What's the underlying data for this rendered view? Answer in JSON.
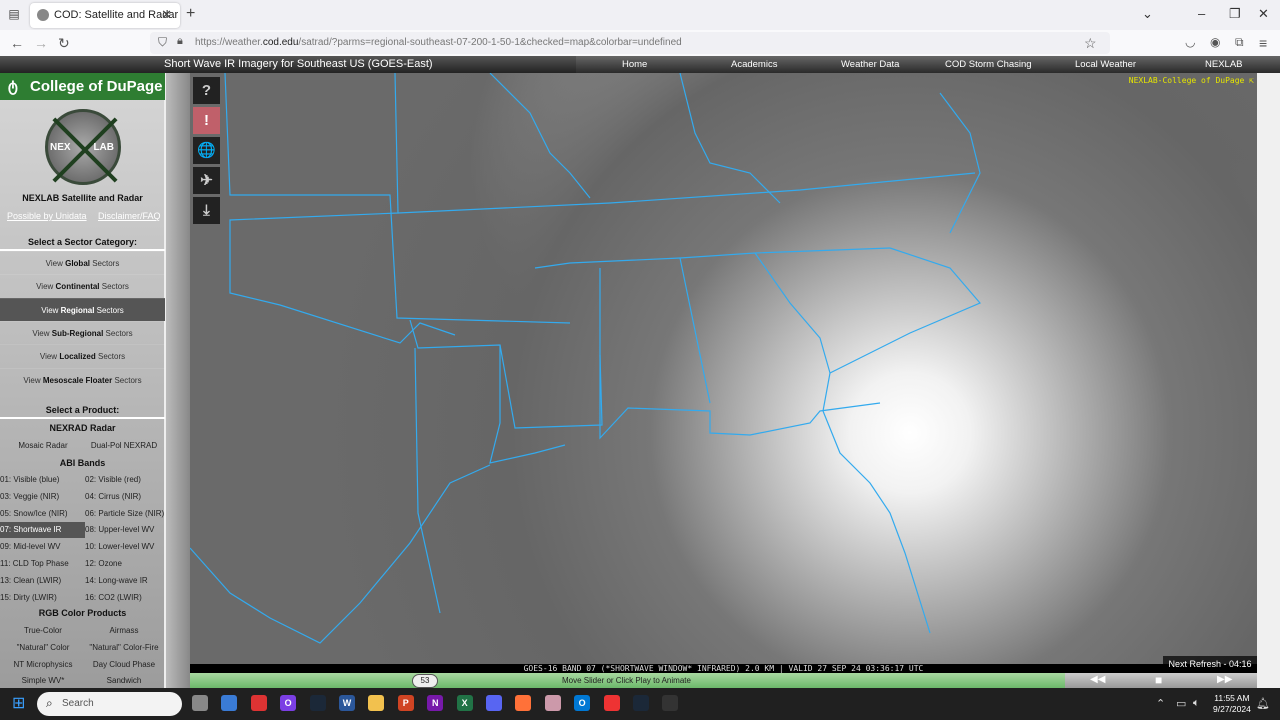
{
  "browser": {
    "tab_title": "COD: Satellite and Radar",
    "url_prefix": "https://weather.",
    "url_domain": "cod.edu",
    "url_path": "/satrad/?parms=regional-southeast-07-200-1-50-1&checked=map&colorbar=undefined",
    "icons": {
      "back": "←",
      "forward": "→",
      "reload": "↻",
      "star": "☆",
      "menu": "≡",
      "close": "✕",
      "new_tab": "+",
      "minimize": "–",
      "restore": "❐",
      "tab_list": "⌄"
    }
  },
  "site": {
    "page_title": "Short Wave IR Imagery for Southeast US (GOES-East)",
    "menu": [
      "Home",
      "Academics",
      "Weather Data",
      "COD Storm Chasing",
      "Local Weather",
      "NEXLAB"
    ],
    "logo_text": "College of DuPage",
    "nexlab_left": "NEX",
    "nexlab_right": "LAB",
    "watermark": "NEXLAB-College of DuPage ⇱"
  },
  "sidebar": {
    "heading": "NEXLAB Satellite and Radar",
    "link_unidata": "Possible by Unidata",
    "link_disclaimer": "Disclaimer/FAQ",
    "sector_heading": "Select a Sector Category:",
    "sectors": [
      {
        "pre": "View ",
        "bold": "Global",
        "post": " Sectors",
        "active": false
      },
      {
        "pre": "View ",
        "bold": "Continental",
        "post": " Sectors",
        "active": false
      },
      {
        "pre": "View ",
        "bold": "Regional",
        "post": " Sectors",
        "active": true
      },
      {
        "pre": "View ",
        "bold": "Sub-Regional",
        "post": " Sectors",
        "active": false
      },
      {
        "pre": "View ",
        "bold": "Localized",
        "post": " Sectors",
        "active": false
      },
      {
        "pre": "View ",
        "bold": "Mesoscale Floater",
        "post": " Sectors",
        "active": false
      }
    ],
    "product_heading": "Select a Product:",
    "nexrad_heading": "NEXRAD Radar",
    "nexrad": [
      "Mosaic Radar",
      "Dual-Pol NEXRAD"
    ],
    "abi_heading": "ABI Bands",
    "abi_bands": [
      "01: Visible (blue)",
      "02: Visible (red)",
      "03: Veggie (NIR)",
      "04: Cirrus (NIR)",
      "05: Snow/Ice (NIR)",
      "06: Particle Size (NIR)",
      "07: Shortwave IR",
      "08: Upper-level WV",
      "09: Mid-level WV",
      "10: Lower-level WV",
      "11: CLD Top Phase",
      "12: Ozone",
      "13: Clean (LWIR)",
      "14: Long-wave IR",
      "15: Dirty (LWIR)",
      "16: CO2 (LWIR)"
    ],
    "active_band": "07: Shortwave IR",
    "rgb_heading": "RGB Color Products",
    "rgb": [
      "True-Color",
      "Airmass",
      "\"Natural\" Color",
      "\"Natural\" Color-Fire",
      "NT Microphysics",
      "Day Cloud Phase",
      "Simple WV*",
      "Sandwich"
    ]
  },
  "tools": [
    {
      "name": "help",
      "glyph": "?"
    },
    {
      "name": "alert",
      "glyph": "!"
    },
    {
      "name": "globe",
      "glyph": "🌐"
    },
    {
      "name": "satellite",
      "glyph": "✈"
    },
    {
      "name": "download",
      "glyph": "⤓"
    }
  ],
  "viewer": {
    "info": "GOES-16 BAND 07 (*SHORTWAVE WINDOW* INFRARED) 2.0 KM | VALID 27 SEP 24 03:36:17 UTC",
    "next_refresh": "Next Refresh - 04:16",
    "frame": "53",
    "slider_label": "Move Slider or Click Play to Animate",
    "prev": "◀◀",
    "stop": "■",
    "next": "▶▶"
  },
  "taskbar": {
    "search_placeholder": "Search",
    "time": "11:55 AM",
    "date": "9/27/2024",
    "apps": [
      {
        "name": "task-view",
        "color": "#888",
        "label": ""
      },
      {
        "name": "store",
        "color": "#3a7bd5",
        "label": ""
      },
      {
        "name": "snipping-tool",
        "color": "#d33",
        "label": ""
      },
      {
        "name": "cortana",
        "color": "#7b3fe4",
        "label": "O"
      },
      {
        "name": "steam",
        "color": "#1b2838",
        "label": ""
      },
      {
        "name": "word",
        "color": "#2b579a",
        "label": "W"
      },
      {
        "name": "file-explorer",
        "color": "#f2c14e",
        "label": ""
      },
      {
        "name": "powerpoint",
        "color": "#d04423",
        "label": "P"
      },
      {
        "name": "onenote",
        "color": "#7719aa",
        "label": "N"
      },
      {
        "name": "excel",
        "color": "#217346",
        "label": "X"
      },
      {
        "name": "discord",
        "color": "#5865f2",
        "label": ""
      },
      {
        "name": "firefox",
        "color": "#ff7139",
        "label": ""
      },
      {
        "name": "color-app",
        "color": "#c9a",
        "label": ""
      },
      {
        "name": "outlook",
        "color": "#0078d4",
        "label": "O"
      },
      {
        "name": "red-app",
        "color": "#e33",
        "label": ""
      },
      {
        "name": "steam-2",
        "color": "#1b2838",
        "label": ""
      },
      {
        "name": "obs",
        "color": "#333",
        "label": ""
      }
    ]
  }
}
